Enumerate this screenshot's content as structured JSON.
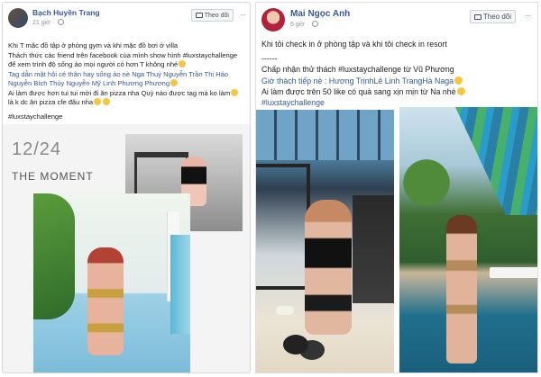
{
  "left_post": {
    "author": "Bạch Huyền Trang",
    "time": "21 giờ",
    "follow_label": "Theo dõi",
    "more": "···",
    "lines": [
      "Khi T mặc đồ tập ở phòng gym và khi mặc đồ bơi ở villa",
      "Thách thức các friend trên facebook của mình show hình #luxstaychallenge",
      "để xem trình độ sống ảo mọi người có hơn T không nhé",
      "Tag dẫn mặt hội cé thân hay sống ảo nè Nga Thuỷ Nguyễn Trần Thị Hảo",
      "Nguyễn Bích Thủy Nguyễn Mỹ Linh Phương Phương",
      "Ai làm được hơn tui tui mời đi ăn pizza nha  Quỷ nào được tag mà ko làm",
      "là k dc ăn pizza cfe đâu nha",
      "#luxstaychallenge"
    ],
    "moment_date": "12/24",
    "moment_title": "THE MOMENT"
  },
  "right_post": {
    "author": "Mai Ngọc Anh",
    "time": "5 giờ",
    "follow_label": "Theo dõi",
    "more": "···",
    "lines": [
      "Khi tôi check in ở phòng tập và khi tôi check in resort",
      "------",
      "Chấp nhận thử thách #luxstaychallenge từ Vũ Phương",
      "Giờ thách tiếp nè : Hương TrịnhLê Linh TrangHà Naga",
      "Ai làm được trên 50 like có quà sang xịn mịn từ Na nhé",
      "#luxstaychallenge"
    ]
  },
  "colors": {
    "link_blue": "#365899",
    "name_blue": "#385898",
    "meta_gray": "#90949c",
    "border": "#d3d6db"
  },
  "icons": {
    "globe": "globe-icon",
    "follow": "rss-follow-icon",
    "more": "more-horizontal-icon"
  }
}
